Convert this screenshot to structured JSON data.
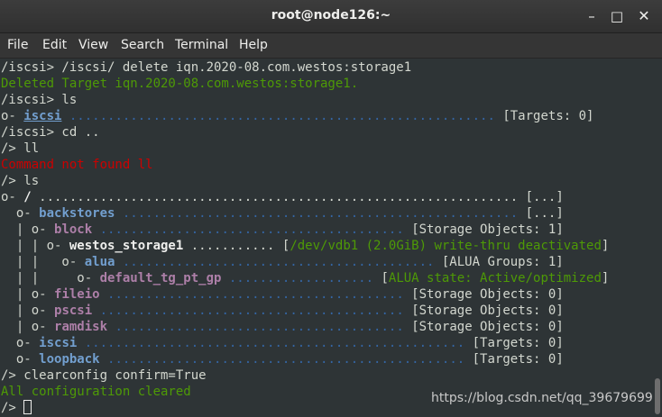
{
  "window": {
    "title": "root@node126:~",
    "minimize_glyph": "–",
    "maximize_glyph": "□",
    "close_glyph": "✕"
  },
  "menubar": {
    "items": [
      "File",
      "Edit",
      "View",
      "Search",
      "Terminal",
      "Help"
    ]
  },
  "terminal": {
    "lines": [
      [
        {
          "t": "/iscsi> /iscsi/ delete iqn.2020-08.com.westos:storage1",
          "c": "default"
        }
      ],
      [
        {
          "t": "Deleted Target iqn.2020-08.com.westos:storage1.",
          "c": "green"
        }
      ],
      [
        {
          "t": "/iscsi> ls",
          "c": "default"
        }
      ],
      [
        {
          "t": "o- ",
          "c": "default"
        },
        {
          "t": "iscsi",
          "c": "blue-u"
        },
        {
          "t": " ........................................................ ",
          "c": "dots"
        },
        {
          "t": "[Targets: 0]",
          "c": "default"
        }
      ],
      [
        {
          "t": "/iscsi> cd ..",
          "c": "default"
        }
      ],
      [
        {
          "t": "/> ll",
          "c": "default"
        }
      ],
      [
        {
          "t": "Command not found ll",
          "c": "red"
        }
      ],
      [
        {
          "t": "/> ls",
          "c": "default"
        }
      ],
      [
        {
          "t": "o- ",
          "c": "default"
        },
        {
          "t": "/",
          "c": "white"
        },
        {
          "t": " ............................................................... ",
          "c": "default"
        },
        {
          "t": "[...]",
          "c": "default"
        }
      ],
      [
        {
          "t": "  o- ",
          "c": "default"
        },
        {
          "t": "backstores",
          "c": "blue"
        },
        {
          "t": " .................................................... ",
          "c": "dots"
        },
        {
          "t": "[...]",
          "c": "default"
        }
      ],
      [
        {
          "t": "  | o- ",
          "c": "default"
        },
        {
          "t": "block",
          "c": "mag"
        },
        {
          "t": " ........................................ ",
          "c": "dots"
        },
        {
          "t": "[Storage Objects: 1]",
          "c": "default"
        }
      ],
      [
        {
          "t": "  | | o- ",
          "c": "default"
        },
        {
          "t": "westos_storage1",
          "c": "white"
        },
        {
          "t": " ........... ",
          "c": "default"
        },
        {
          "t": "[",
          "c": "default"
        },
        {
          "t": "/dev/vdb1 (2.0GiB) write-thru deactivated",
          "c": "green"
        },
        {
          "t": "]",
          "c": "default"
        }
      ],
      [
        {
          "t": "  | |   o- ",
          "c": "default"
        },
        {
          "t": "alua",
          "c": "blue"
        },
        {
          "t": " ......................................... ",
          "c": "dots"
        },
        {
          "t": "[ALUA Groups: 1]",
          "c": "default"
        }
      ],
      [
        {
          "t": "  | |     o- ",
          "c": "default"
        },
        {
          "t": "default_tg_pt_gp",
          "c": "mag"
        },
        {
          "t": " ................... ",
          "c": "dots"
        },
        {
          "t": "[",
          "c": "default"
        },
        {
          "t": "ALUA state: Active/optimized",
          "c": "green"
        },
        {
          "t": "]",
          "c": "default"
        }
      ],
      [
        {
          "t": "  | o- ",
          "c": "default"
        },
        {
          "t": "fileio",
          "c": "mag"
        },
        {
          "t": " ....................................... ",
          "c": "dots"
        },
        {
          "t": "[Storage Objects: 0]",
          "c": "default"
        }
      ],
      [
        {
          "t": "  | o- ",
          "c": "default"
        },
        {
          "t": "pscsi",
          "c": "mag"
        },
        {
          "t": " ........................................ ",
          "c": "dots"
        },
        {
          "t": "[Storage Objects: 0]",
          "c": "default"
        }
      ],
      [
        {
          "t": "  | o- ",
          "c": "default"
        },
        {
          "t": "ramdisk",
          "c": "mag"
        },
        {
          "t": " ...................................... ",
          "c": "dots"
        },
        {
          "t": "[Storage Objects: 0]",
          "c": "default"
        }
      ],
      [
        {
          "t": "  o- ",
          "c": "default"
        },
        {
          "t": "iscsi",
          "c": "blue"
        },
        {
          "t": " .................................................. ",
          "c": "dots"
        },
        {
          "t": "[Targets: 0]",
          "c": "default"
        }
      ],
      [
        {
          "t": "  o- ",
          "c": "default"
        },
        {
          "t": "loopback",
          "c": "blue"
        },
        {
          "t": " ............................................... ",
          "c": "dots"
        },
        {
          "t": "[Targets: 0]",
          "c": "default"
        }
      ],
      [
        {
          "t": "/> clearconfig confirm=True",
          "c": "default"
        }
      ],
      [
        {
          "t": "All configuration cleared",
          "c": "green"
        }
      ],
      [
        {
          "t": "/> ",
          "c": "default"
        }
      ]
    ]
  },
  "watermark": "https://blog.csdn.net/qq_39679699",
  "colors": {
    "background": "#2e3436",
    "green": "#4e9a06",
    "red": "#cc0000",
    "blue": "#729fcf",
    "magenta": "#ad7fa8"
  }
}
